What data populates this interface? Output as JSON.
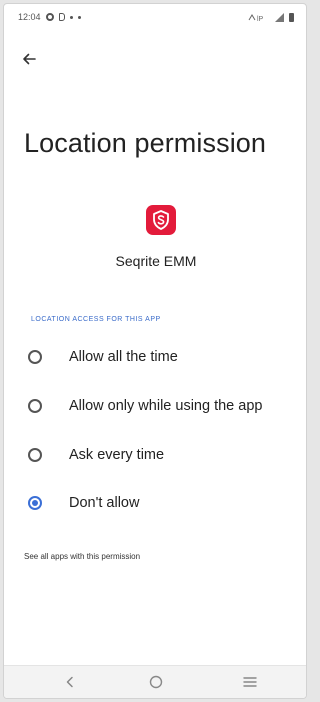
{
  "status_bar": {
    "time": "12:04",
    "right_text": "ᴺ⁵ᴳ"
  },
  "header": {
    "back_icon": "arrow-left-icon",
    "title": "Location permission"
  },
  "app": {
    "icon": "seqrite-shield-icon",
    "icon_color": "#e31b3b",
    "name": "Seqrite EMM"
  },
  "section": {
    "header": "LOCATION ACCESS FOR THIS APP",
    "header_color": "#3a6bc9"
  },
  "options": [
    {
      "label": "Allow all the time",
      "selected": false
    },
    {
      "label": "Allow only while using the app",
      "selected": false
    },
    {
      "label": "Ask every time",
      "selected": false
    },
    {
      "label": "Don't allow",
      "selected": true
    }
  ],
  "accent_color": "#3b6fd6",
  "link": {
    "label": "See all apps with this permission"
  },
  "nav": {
    "back_icon": "chevron-left-icon",
    "home_icon": "circle-home-icon",
    "recents_icon": "menu-lines-icon"
  }
}
